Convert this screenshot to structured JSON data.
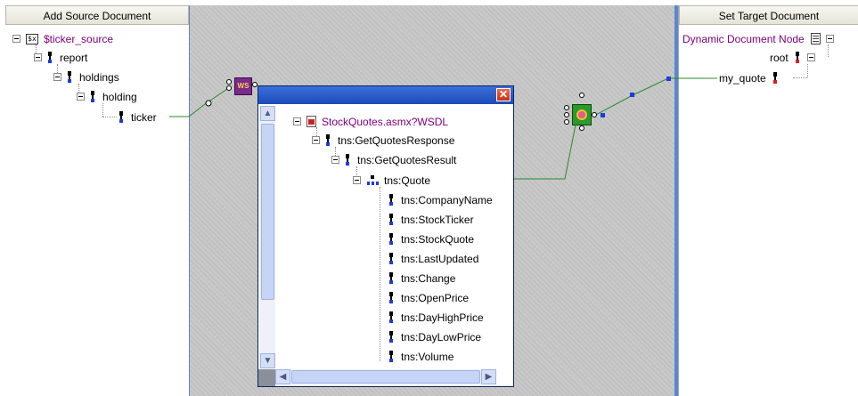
{
  "left_pane": {
    "header": "Add Source Document",
    "root": "$ticker_source",
    "nodes": {
      "report": "report",
      "holdings": "holdings",
      "holding": "holding",
      "ticker": "ticker"
    }
  },
  "right_pane": {
    "header": "Set Target Document",
    "root": "Dynamic Document Node",
    "nodes": {
      "root": "root",
      "my_quote": "my_quote"
    }
  },
  "popup": {
    "root": "StockQuotes.asmx?WSDL",
    "response": "tns:GetQuotesResponse",
    "result": "tns:GetQuotesResult",
    "quote": "tns:Quote",
    "fields": [
      "tns:CompanyName",
      "tns:StockTicker",
      "tns:StockQuote",
      "tns:LastUpdated",
      "tns:Change",
      "tns:OpenPrice",
      "tns:DayHighPrice",
      "tns:DayLowPrice",
      "tns:Volume"
    ]
  },
  "icons": {
    "ws_label": "WS",
    "close_glyph": "✕",
    "variable_glyph": "$x"
  },
  "colors": {
    "accent_purple": "#800080",
    "wire": "#2a8a2a",
    "titlebar": "#2a5bc8"
  }
}
